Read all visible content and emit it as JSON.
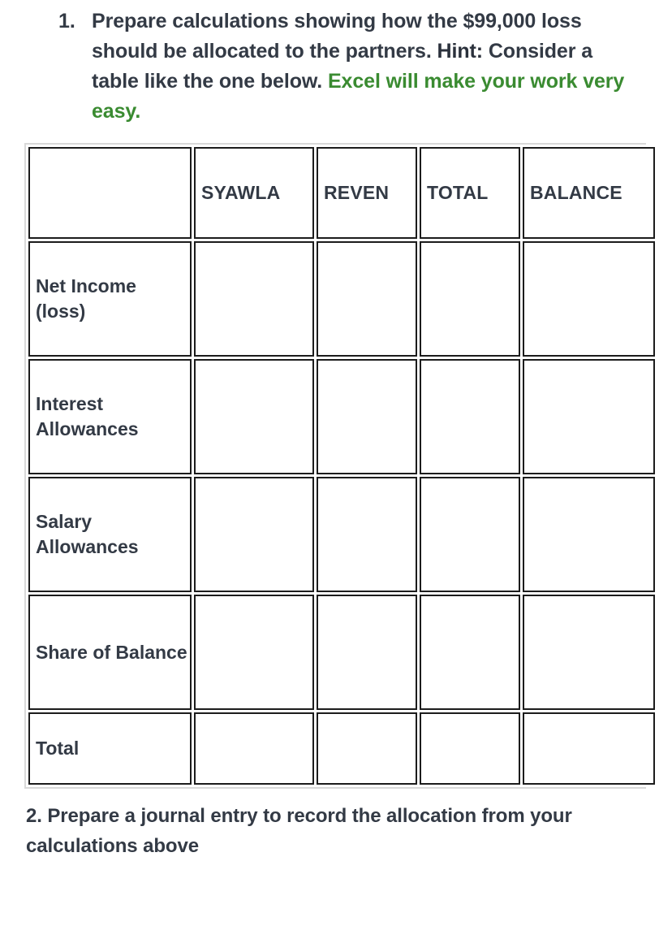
{
  "question1": {
    "marker": "1.",
    "text_part1": "Prepare calculations showing how the $99,000 loss should be allocated to the partners. ",
    "hint_label": "Hint:",
    "text_part2": " Consider a table like the one below. ",
    "green_text": "Excel will make your work very easy."
  },
  "table": {
    "columns": [
      "",
      "SYAWLA",
      "REVEN",
      "TOTAL",
      "BALANCE"
    ],
    "rows": [
      {
        "label": "Net Income (loss)",
        "cells": [
          "",
          "",
          "",
          ""
        ]
      },
      {
        "label": "Interest Allowances",
        "cells": [
          "",
          "",
          "",
          ""
        ]
      },
      {
        "label": "Salary Allowances",
        "cells": [
          "",
          "",
          "",
          ""
        ]
      },
      {
        "label": "Share of Balance",
        "cells": [
          "",
          "",
          "",
          ""
        ]
      },
      {
        "label": "Total",
        "cells": [
          "",
          "",
          "",
          ""
        ]
      }
    ]
  },
  "question2": {
    "text": "2. Prepare a journal entry to record the allocation from your calculations above"
  },
  "colors": {
    "text": "#333a45",
    "accent_green": "#3a8b31",
    "cell_border": "#1c1c1c",
    "table_outer_border": "#d9d9d9",
    "background": "#ffffff"
  }
}
